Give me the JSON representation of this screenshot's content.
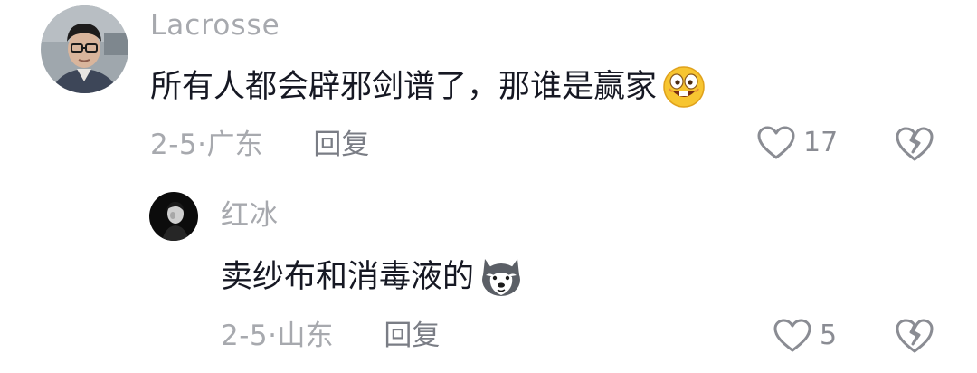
{
  "comments": [
    {
      "username": "Lacrosse",
      "text": "所有人都会辟邪剑谱了，那谁是赢家",
      "emoji": "grinning-emoji",
      "date": "2-5·",
      "location": "广东",
      "reply_label": "回复",
      "like_count": "17",
      "avatar": "man-with-glasses-avatar"
    },
    {
      "username": "红冰",
      "text": "卖纱布和消毒液的",
      "emoji": "husky-dog-emoji",
      "date": "2-5·",
      "location": "山东",
      "reply_label": "回复",
      "like_count": "5",
      "avatar": "dark-portrait-avatar"
    }
  ],
  "colors": {
    "meta_text": "#a7a9ae",
    "body_text": "#161823",
    "icon": "#8a8c93"
  }
}
